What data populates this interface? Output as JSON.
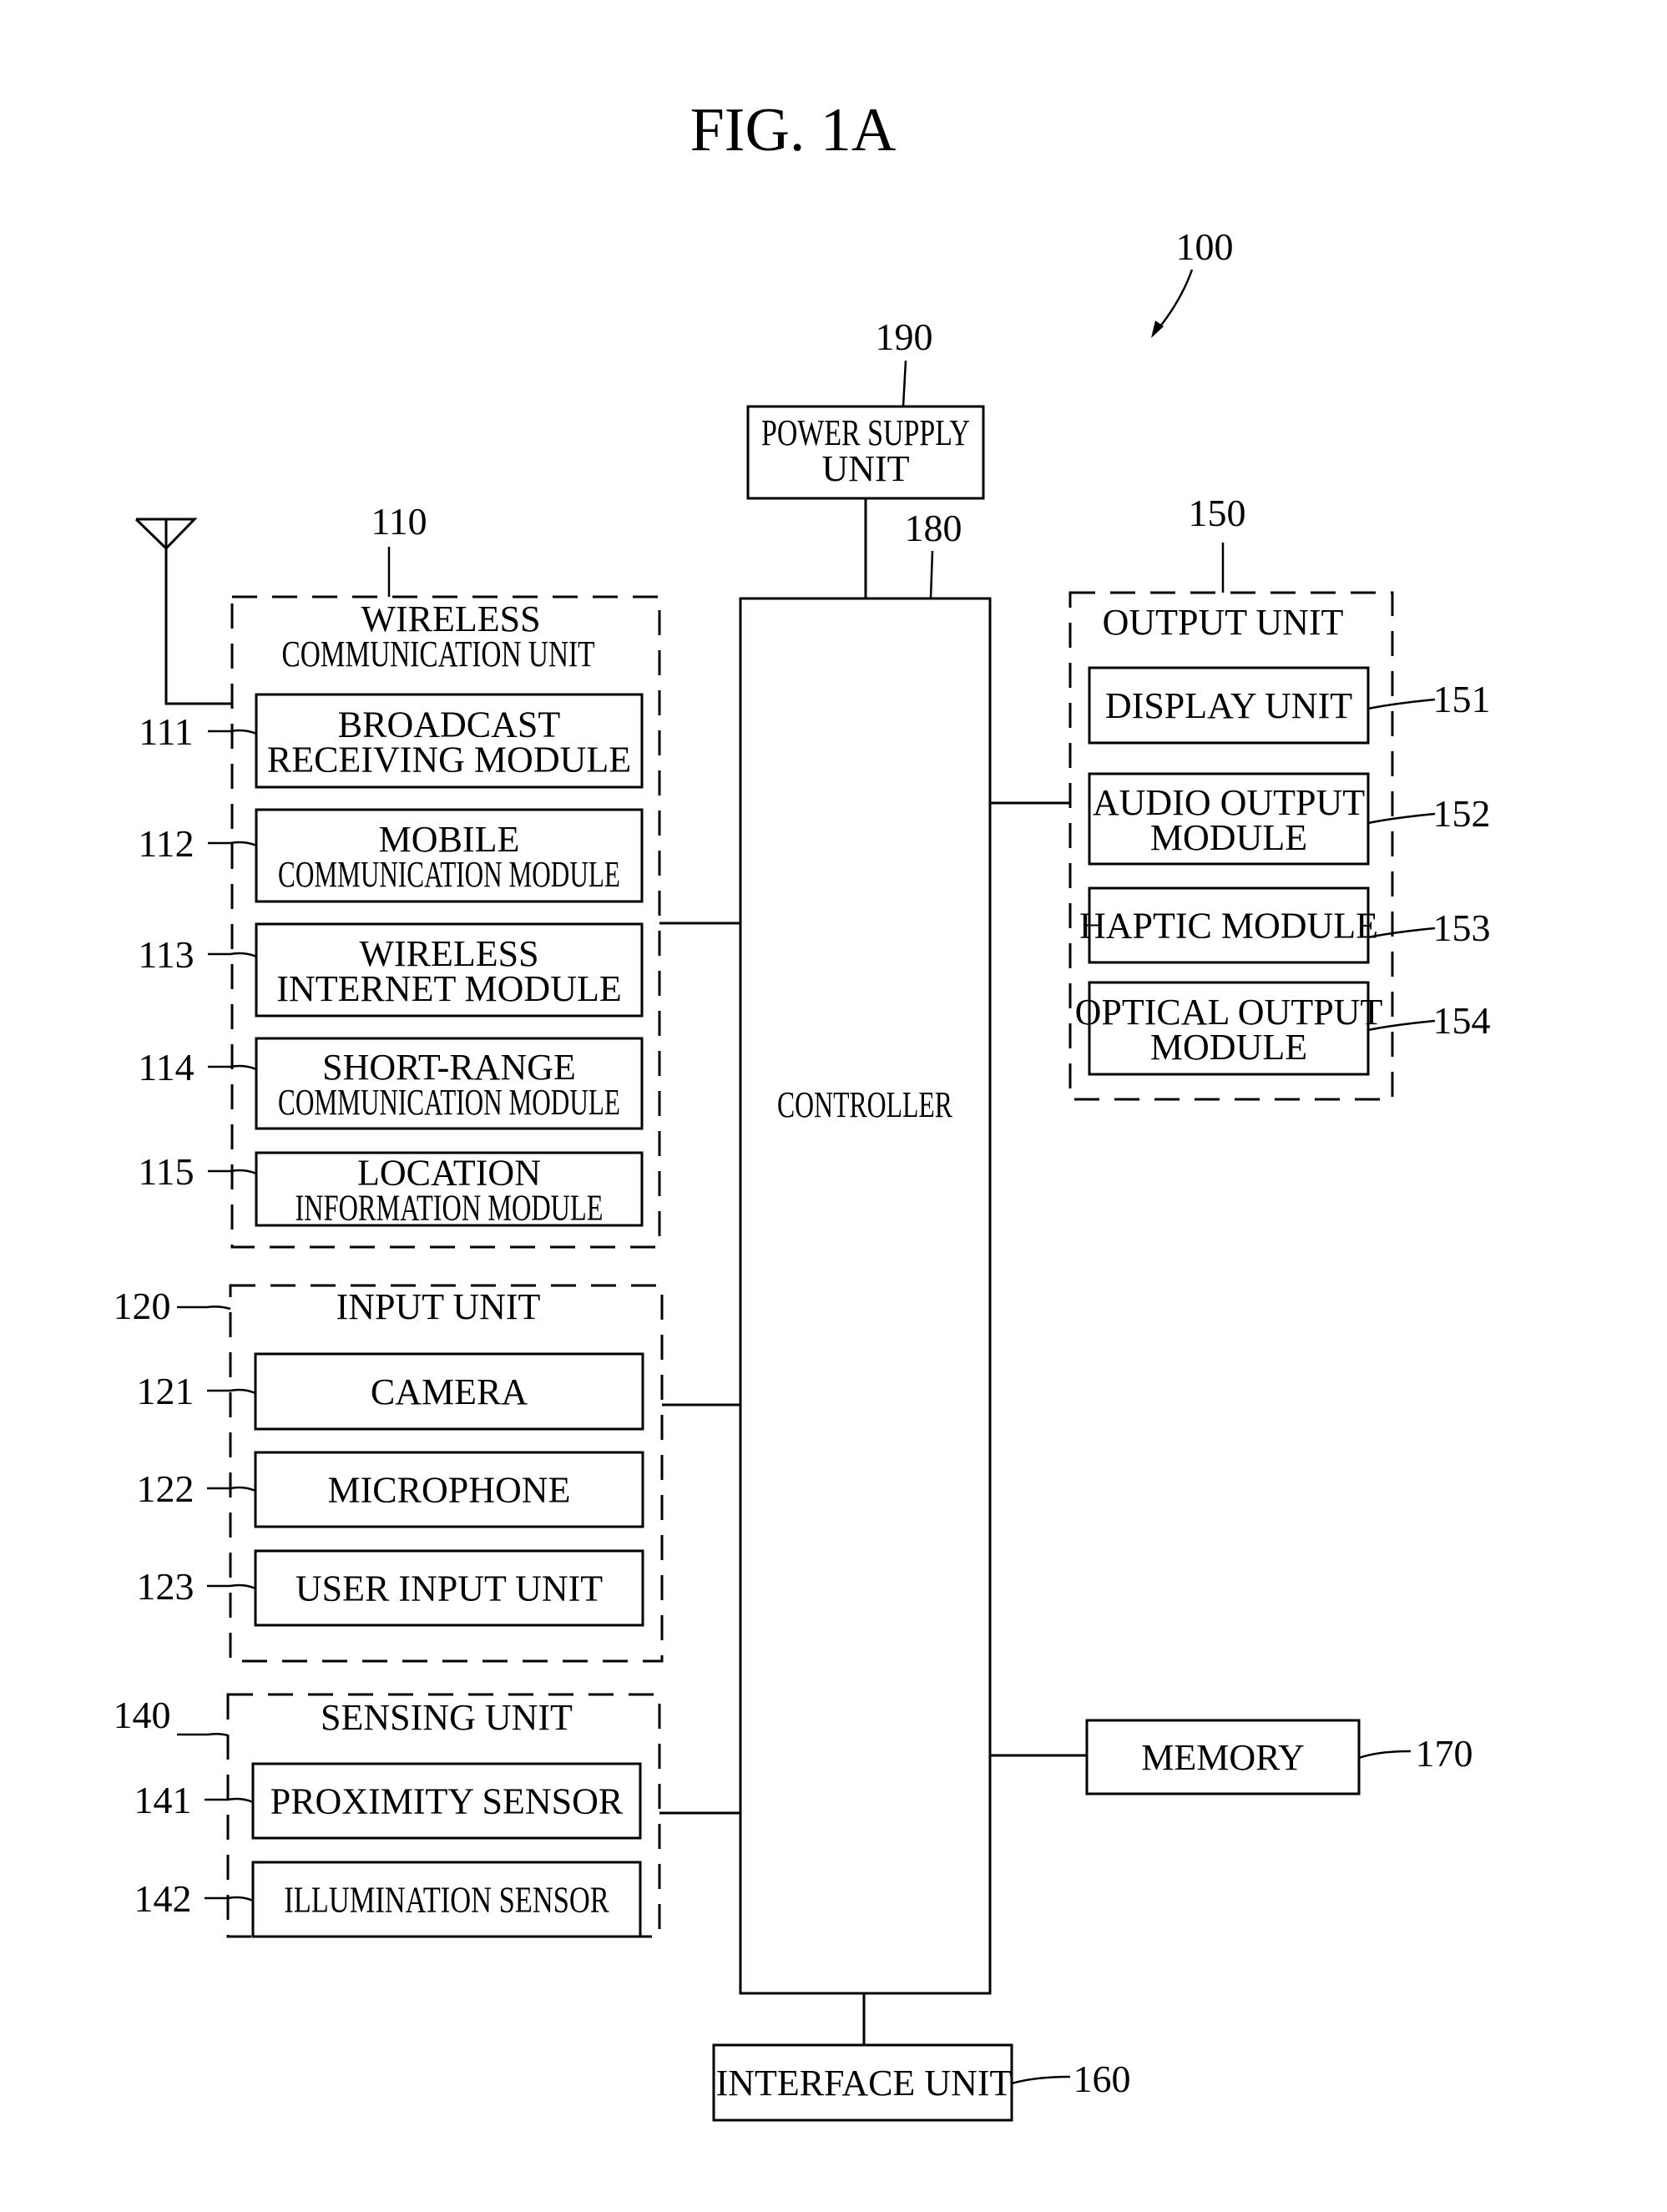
{
  "figure": {
    "title": "FIG. 1A",
    "device_ref": "100",
    "colors": {
      "ink": "#000000",
      "paper": "#ffffff"
    }
  },
  "power_supply": {
    "ref": "190",
    "lines": [
      "POWER SUPPLY",
      "UNIT"
    ]
  },
  "controller": {
    "ref": "180",
    "label": "CONTROLLER"
  },
  "wireless_unit": {
    "ref": "110",
    "lines": [
      "WIRELESS",
      "COMMUNICATION UNIT"
    ],
    "antenna_icon": "antenna-icon",
    "modules": [
      {
        "ref": "111",
        "lines": [
          "BROADCAST",
          "RECEIVING MODULE"
        ]
      },
      {
        "ref": "112",
        "lines": [
          "MOBILE",
          "COMMUNICATION MODULE"
        ]
      },
      {
        "ref": "113",
        "lines": [
          "WIRELESS",
          "INTERNET MODULE"
        ]
      },
      {
        "ref": "114",
        "lines": [
          "SHORT-RANGE",
          "COMMUNICATION MODULE"
        ]
      },
      {
        "ref": "115",
        "lines": [
          "LOCATION",
          "INFORMATION MODULE"
        ]
      }
    ]
  },
  "input_unit": {
    "ref": "120",
    "label": "INPUT UNIT",
    "modules": [
      {
        "ref": "121",
        "lines": [
          "CAMERA"
        ]
      },
      {
        "ref": "122",
        "lines": [
          "MICROPHONE"
        ]
      },
      {
        "ref": "123",
        "lines": [
          "USER INPUT UNIT"
        ]
      }
    ]
  },
  "sensing_unit": {
    "ref": "140",
    "label": "SENSING UNIT",
    "modules": [
      {
        "ref": "141",
        "lines": [
          "PROXIMITY SENSOR"
        ]
      },
      {
        "ref": "142",
        "lines": [
          "ILLUMINATION SENSOR"
        ]
      }
    ]
  },
  "output_unit": {
    "ref": "150",
    "label": "OUTPUT UNIT",
    "modules": [
      {
        "ref": "151",
        "lines": [
          "DISPLAY UNIT"
        ]
      },
      {
        "ref": "152",
        "lines": [
          "AUDIO OUTPUT",
          "MODULE"
        ]
      },
      {
        "ref": "153",
        "lines": [
          "HAPTIC MODULE"
        ]
      },
      {
        "ref": "154",
        "lines": [
          "OPTICAL OUTPUT",
          "MODULE"
        ]
      }
    ]
  },
  "memory": {
    "ref": "170",
    "label": "MEMORY"
  },
  "interface_unit": {
    "ref": "160",
    "label": "INTERFACE UNIT"
  }
}
